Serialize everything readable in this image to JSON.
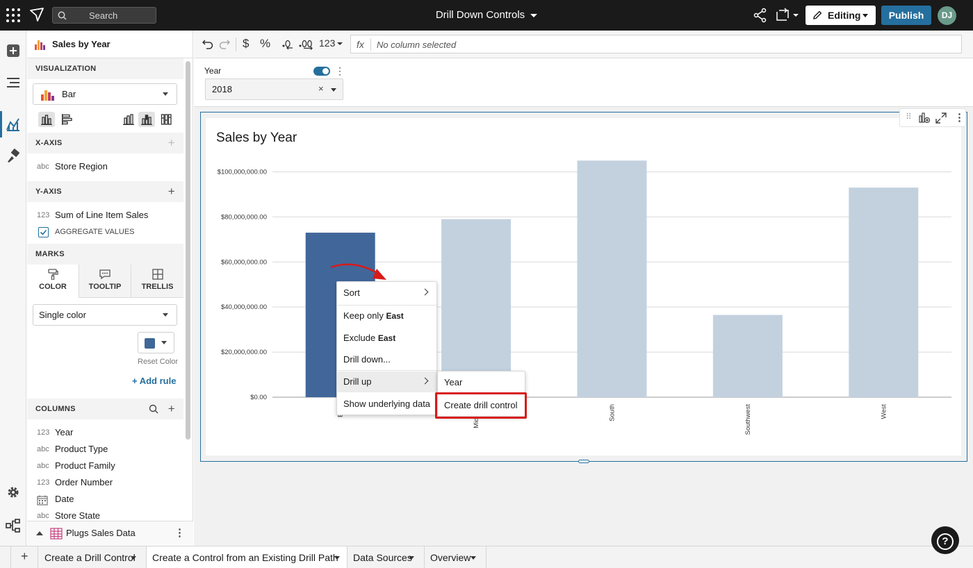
{
  "topbar": {
    "search_placeholder": "Search",
    "doc_title": "Drill Down Controls",
    "editing_label": "Editing",
    "publish_label": "Publish",
    "avatar_initials": "DJ"
  },
  "toolbar": {
    "format_currency": "$",
    "format_percent": "%",
    "format_number": "123",
    "fx_label": "fx",
    "formula_placeholder": "No column selected"
  },
  "control": {
    "label": "Year",
    "value": "2018",
    "clear": "×"
  },
  "panel": {
    "title": "Sales by Year",
    "visualization_header": "VISUALIZATION",
    "viz_type": "Bar",
    "xaxis_header": "X-AXIS",
    "xaxis_field": {
      "type": "abc",
      "name": "Store Region"
    },
    "yaxis_header": "Y-AXIS",
    "yaxis_field": {
      "type": "123",
      "name": "Sum of Line Item Sales"
    },
    "aggregate_label": "AGGREGATE VALUES",
    "marks_header": "MARKS",
    "marks_tabs": [
      "COLOR",
      "TOOLTIP",
      "TRELLIS"
    ],
    "color_mode": "Single color",
    "swatch_color": "#3f6797",
    "reset_color": "Reset Color",
    "add_rule": "+ Add rule",
    "columns_header": "COLUMNS",
    "columns": [
      {
        "type": "123",
        "name": "Year"
      },
      {
        "type": "abc",
        "name": "Product Type"
      },
      {
        "type": "abc",
        "name": "Product Family"
      },
      {
        "type": "123",
        "name": "Order Number"
      },
      {
        "type": "cal",
        "name": "Date"
      },
      {
        "type": "abc",
        "name": "Store State"
      }
    ],
    "source_name": "Plugs Sales Data"
  },
  "chart_data": {
    "type": "bar",
    "title": "Sales by Year",
    "categories": [
      "East",
      "Midwest",
      "South",
      "Southwest",
      "West"
    ],
    "values": [
      73000000,
      79000000,
      105000000,
      36500000,
      93000000
    ],
    "ylim": [
      0,
      110000000
    ],
    "yticks": [
      "$0.00",
      "$20,000,000.00",
      "$40,000,000.00",
      "$60,000,000.00",
      "$80,000,000.00",
      "$100,000,000.00"
    ],
    "selected_index": 0,
    "colors": {
      "selected": "#41679a",
      "default": "#c3d1df"
    },
    "grid": true
  },
  "context_menu": {
    "sort": "Sort",
    "keep_only_prefix": "Keep only ",
    "keep_only_value": "East",
    "exclude_prefix": "Exclude ",
    "exclude_value": "East",
    "drill_down": "Drill down...",
    "drill_up": "Drill up",
    "show_underlying": "Show underlying data"
  },
  "submenu": {
    "year": "Year",
    "create_drill_control": "Create drill control"
  },
  "tabs": [
    {
      "label": "Create a Drill Control",
      "active": false
    },
    {
      "label": "Create a Control from an Existing Drill Path",
      "active": true
    },
    {
      "label": "Data Sources",
      "active": false
    },
    {
      "label": "Overview",
      "active": false
    }
  ],
  "help_symbol": "?"
}
